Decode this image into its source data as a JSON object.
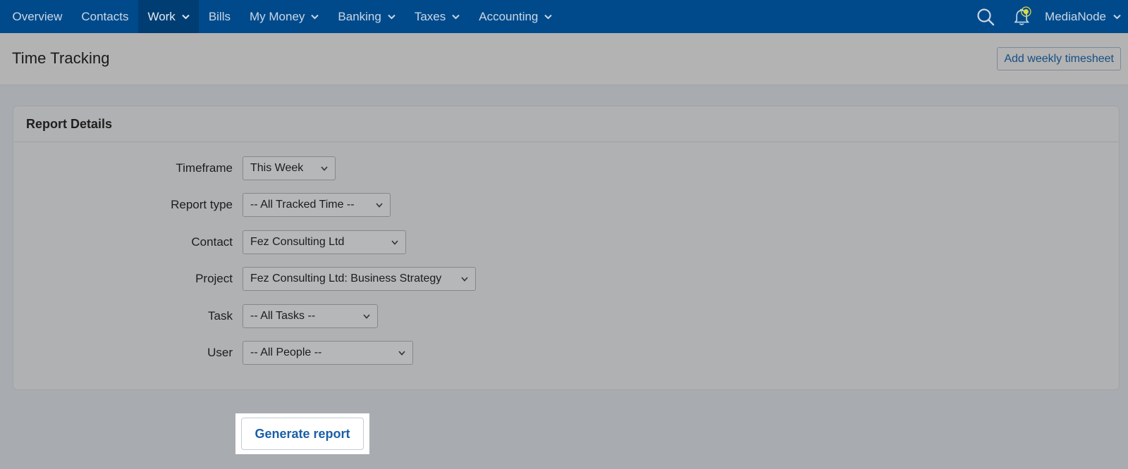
{
  "nav": {
    "items": [
      {
        "label": "Overview",
        "dropdown": false,
        "active": false
      },
      {
        "label": "Contacts",
        "dropdown": false,
        "active": false
      },
      {
        "label": "Work",
        "dropdown": true,
        "active": true
      },
      {
        "label": "Bills",
        "dropdown": false,
        "active": false
      },
      {
        "label": "My Money",
        "dropdown": true,
        "active": false
      },
      {
        "label": "Banking",
        "dropdown": true,
        "active": false
      },
      {
        "label": "Taxes",
        "dropdown": true,
        "active": false
      },
      {
        "label": "Accounting",
        "dropdown": true,
        "active": false
      }
    ],
    "account_name": "MediaNode",
    "icons": {
      "search": "search-icon",
      "notifications": "bell-icon"
    }
  },
  "page": {
    "title": "Time Tracking",
    "add_timesheet_label": "Add weekly timesheet"
  },
  "report_details": {
    "title": "Report Details",
    "fields": {
      "timeframe": {
        "label": "Timeframe",
        "value": "This Week"
      },
      "report_type": {
        "label": "Report type",
        "value": "-- All Tracked Time --"
      },
      "contact": {
        "label": "Contact",
        "value": "Fez Consulting Ltd"
      },
      "project": {
        "label": "Project",
        "value": "Fez Consulting Ltd: Business Strategy"
      },
      "task": {
        "label": "Task",
        "value": "-- All Tasks --"
      },
      "user": {
        "label": "User",
        "value": "-- All People --"
      }
    }
  },
  "actions": {
    "generate_report_label": "Generate report"
  },
  "colors": {
    "nav_bg": "#004a8b",
    "nav_active_bg": "#003d73",
    "link_blue": "#1a5fa7",
    "notification_accent": "#d8d84a"
  }
}
